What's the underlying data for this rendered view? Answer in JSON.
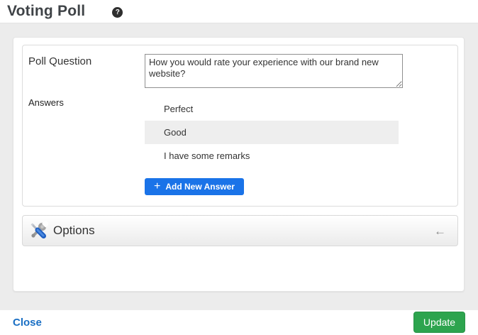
{
  "header": {
    "title": "Voting Poll"
  },
  "poll_form": {
    "question_label": "Poll Question",
    "question_value": "How you would rate your experience with our brand new website?",
    "answers_label": "Answers",
    "answers": [
      {
        "text": "Perfect",
        "highlighted": false
      },
      {
        "text": "Good",
        "highlighted": true
      },
      {
        "text": "I have some remarks",
        "highlighted": false
      }
    ],
    "add_answer_button": "Add New Answer",
    "add_answer_plus": "+"
  },
  "options_section": {
    "title": "Options",
    "collapse_arrow": "←"
  },
  "footer": {
    "close_label": "Close",
    "update_label": "Update"
  },
  "colors": {
    "accent_blue": "#1a73e8",
    "success_green": "#2da44e",
    "link_blue": "#1a6fc4",
    "highlight_gray": "#eeeeee",
    "page_gray": "#ececec"
  }
}
